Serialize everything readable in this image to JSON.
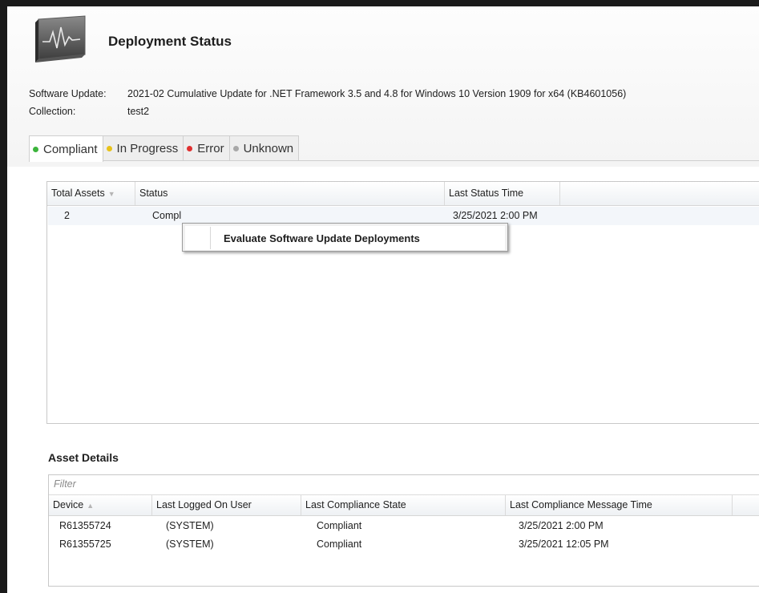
{
  "header": {
    "title": "Deployment Status",
    "icon": "monitor-activity-icon"
  },
  "info": {
    "software_update_label": "Software Update:",
    "software_update_value": "2021-02 Cumulative Update for .NET Framework 3.5 and 4.8 for Windows 10 Version 1909 for x64 (KB4601056)",
    "collection_label": "Collection:",
    "collection_value": "test2"
  },
  "tabs": [
    {
      "label": "Compliant",
      "color": "#3cb43c",
      "active": true
    },
    {
      "label": "In Progress",
      "color": "#e8c21a",
      "active": false
    },
    {
      "label": "Error",
      "color": "#e03030",
      "active": false
    },
    {
      "label": "Unknown",
      "color": "#a8a8a8",
      "active": false
    }
  ],
  "summary": {
    "columns": [
      "Total Assets",
      "Status",
      "Last Status Time"
    ],
    "rows": [
      {
        "total_assets": "2",
        "status": "Compl",
        "last_status_time": "3/25/2021 2:00 PM"
      }
    ]
  },
  "context_menu": {
    "item": "Evaluate Software Update Deployments"
  },
  "asset_details": {
    "title": "Asset Details",
    "filter_placeholder": "Filter",
    "columns": [
      "Device",
      "Last Logged On User",
      "Last Compliance State",
      "Last Compliance Message Time"
    ],
    "rows": [
      {
        "device": "R61355724",
        "user": "(SYSTEM)",
        "state": "Compliant",
        "time": "3/25/2021 2:00 PM"
      },
      {
        "device": "R61355725",
        "user": "(SYSTEM)",
        "state": "Compliant",
        "time": "3/25/2021 12:05 PM"
      }
    ]
  }
}
